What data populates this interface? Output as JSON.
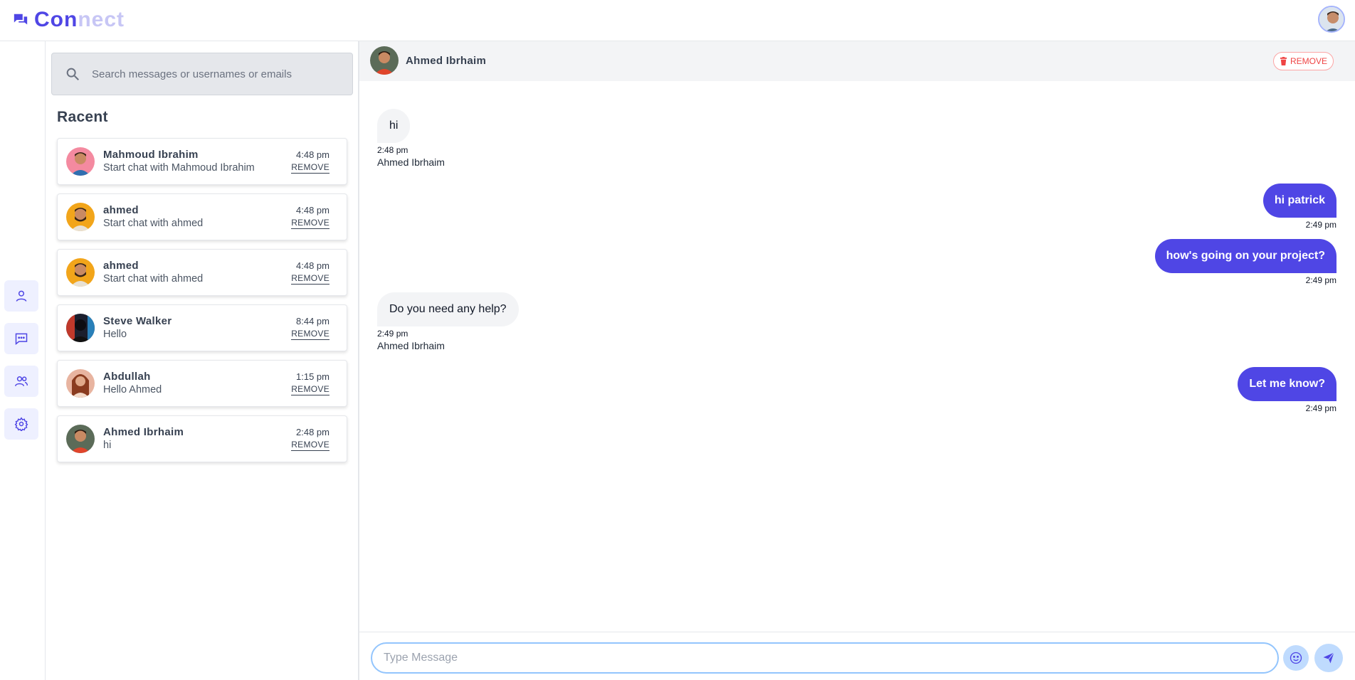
{
  "app": {
    "logo_part1": "Con",
    "logo_part2": "nect"
  },
  "colors": {
    "accent": "#4f46e5",
    "accent_light": "#c7c6f5",
    "danger": "#ef4444",
    "bubble_in": "#f3f4f6"
  },
  "sidebar": {
    "search_placeholder": "Search messages or usernames or emails",
    "recent_title": "Racent",
    "conversations": [
      {
        "name": "Mahmoud Ibrahim",
        "preview": "Start chat with Mahmoud Ibrahim",
        "time": "4:48 pm",
        "remove": "REMOVE"
      },
      {
        "name": "ahmed",
        "preview": "Start chat with ahmed",
        "time": "4:48 pm",
        "remove": "REMOVE"
      },
      {
        "name": "ahmed",
        "preview": "Start chat with ahmed",
        "time": "4:48 pm",
        "remove": "REMOVE"
      },
      {
        "name": "Steve Walker",
        "preview": "Hello",
        "time": "8:44 pm",
        "remove": "REMOVE"
      },
      {
        "name": "Abdullah",
        "preview": "Hello Ahmed",
        "time": "1:15 pm",
        "remove": "REMOVE"
      },
      {
        "name": "Ahmed Ibrhaim",
        "preview": "hi",
        "time": "2:48 pm",
        "remove": "REMOVE"
      }
    ]
  },
  "rail": {
    "icons": [
      "user-icon",
      "chat-icon",
      "users-icon",
      "settings-icon"
    ]
  },
  "chat": {
    "contact_name": "Ahmed Ibrhaim",
    "remove_label": "REMOVE",
    "messages": [
      {
        "direction": "in",
        "text": "hi",
        "time": "2:48 pm",
        "sender": "Ahmed Ibrhaim"
      },
      {
        "direction": "out",
        "text": "hi patrick",
        "time": "2:49 pm"
      },
      {
        "direction": "out",
        "text": "how's going on your project?",
        "time": "2:49 pm"
      },
      {
        "direction": "in",
        "text": "Do you need any help?",
        "time": "2:49 pm",
        "sender": "Ahmed Ibrhaim"
      },
      {
        "direction": "out",
        "text": "Let me know?",
        "time": "2:49 pm"
      }
    ],
    "input_placeholder": "Type Message",
    "input_value": ""
  }
}
